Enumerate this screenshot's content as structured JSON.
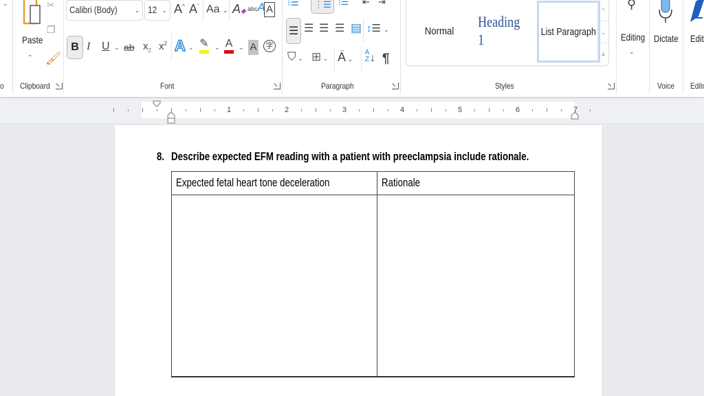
{
  "ribbon": {
    "clipboard": {
      "group_label": "Clipboard",
      "paste_label": "Paste",
      "cut_icon": "scissors-icon",
      "copy_icon": "copy-icon",
      "format_painter_icon": "paintbrush-icon"
    },
    "partial_left_label": "o",
    "font": {
      "group_label": "Font",
      "font_name": "Calibri (Body)",
      "font_size": "12",
      "grow_font": "A",
      "shrink_font": "A",
      "change_case": "Aa",
      "bold": "B",
      "italic": "I",
      "underline": "U",
      "strikethrough": "ab",
      "subscript": "x",
      "superscript": "x",
      "text_effects": "A",
      "highlight_color": "#ffef00",
      "font_color": "#e00000",
      "font_color_letter": "A",
      "shading_letter": "A",
      "clear_format_letter": "A",
      "abc_letter": "abc",
      "char_border_letter": "A",
      "enclose_char": "字"
    },
    "paragraph": {
      "group_label": "Paragraph",
      "sort_letters": "AZ",
      "pilcrow": "¶"
    },
    "styles": {
      "group_label": "Styles",
      "items": [
        {
          "label": "Normal"
        },
        {
          "label": "Heading 1"
        },
        {
          "label": "List Paragraph",
          "selected": true
        }
      ]
    },
    "editing": {
      "label": "Editing"
    },
    "voice": {
      "group_label": "Voice",
      "dictate_label": "Dictate"
    },
    "editor": {
      "group_label": "Edito",
      "label": "Edito"
    }
  },
  "ruler": {
    "numbers": [
      "1",
      "2",
      "3",
      "4",
      "5",
      "6",
      "7"
    ]
  },
  "document": {
    "question_number": "8.",
    "question_text": "Describe expected EFM reading with a patient with preeclampsia include rationale.",
    "table": {
      "headers": [
        "Expected fetal heart tone deceleration",
        "Rationale"
      ],
      "rows": [
        [
          "",
          ""
        ]
      ]
    }
  }
}
